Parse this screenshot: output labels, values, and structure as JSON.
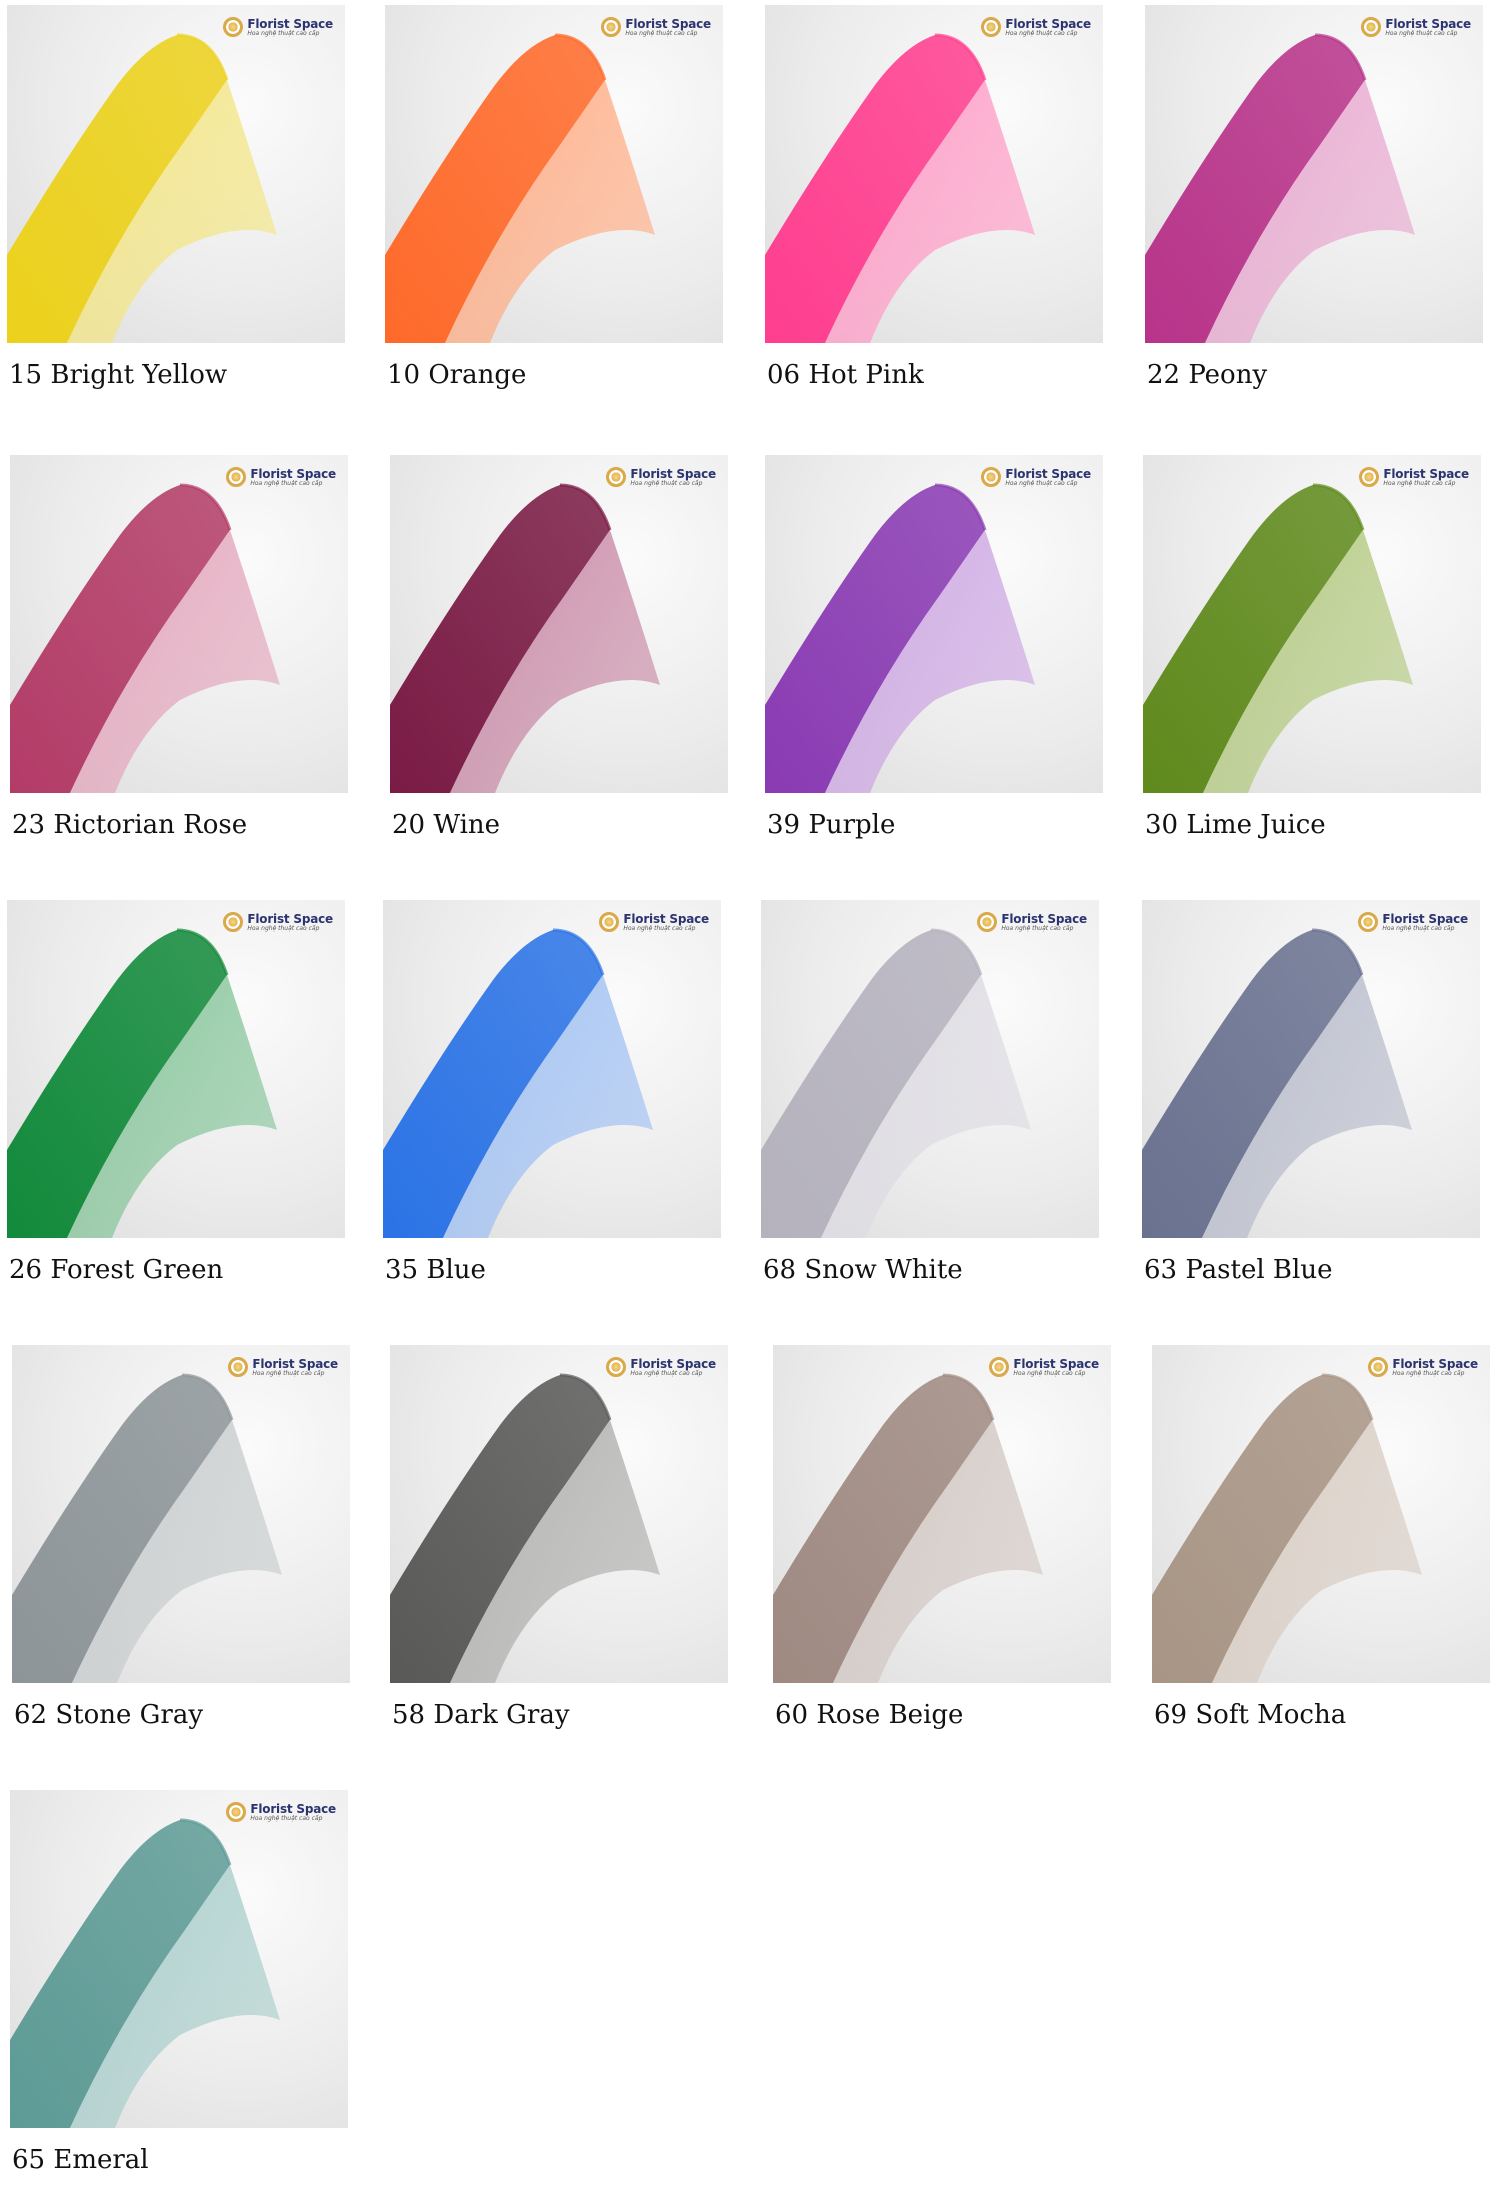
{
  "swatches": [
    {
      "label": "15 Bright Yellow",
      "color": "#ecd11c",
      "light": "#f3e583"
    },
    {
      "label": "10 Orange",
      "color": "#ff6a2a",
      "light": "#ffad85"
    },
    {
      "label": "06 Hot Pink",
      "color": "#ff3e8f",
      "light": "#ff9cc6"
    },
    {
      "label": "22 Peony",
      "color": "#b8348a",
      "light": "#e8a8cf"
    },
    {
      "label": "23 Rictorian Rose",
      "color": "#b33c67",
      "light": "#e3a6bc"
    },
    {
      "label": "20 Wine",
      "color": "#7a1b45",
      "light": "#c98aa6"
    },
    {
      "label": "39 Purple",
      "color": "#8a3bb3",
      "light": "#cda6e3"
    },
    {
      "label": "30 Lime Juice",
      "color": "#5f8a1c",
      "light": "#b2c97f"
    },
    {
      "label": "26 Forest Green",
      "color": "#128a3b",
      "light": "#86c59a"
    },
    {
      "label": "35 Blue",
      "color": "#2b73e6",
      "light": "#9fc0f3"
    },
    {
      "label": "68 Snow White",
      "color": "#b5b2be",
      "light": "#dddbe2"
    },
    {
      "label": "63 Pastel Blue",
      "color": "#6a7290",
      "light": "#b8bccb"
    },
    {
      "label": "62 Stone Gray",
      "color": "#8d9599",
      "light": "#c7cccd"
    },
    {
      "label": "58 Dark Gray",
      "color": "#595a58",
      "light": "#afafad"
    },
    {
      "label": "60 Rose Beige",
      "color": "#9f8a82",
      "light": "#d2c7c2"
    },
    {
      "label": "69 Soft Mocha",
      "color": "#a89585",
      "light": "#d8ccc2"
    },
    {
      "label": "65 Emeral",
      "color": "#5e9b96",
      "light": "#a9cecb"
    }
  ],
  "logo": {
    "name": "Florist Space",
    "tagline": "Hoa nghệ thuật cao cấp",
    "icon": "flower-icon"
  }
}
